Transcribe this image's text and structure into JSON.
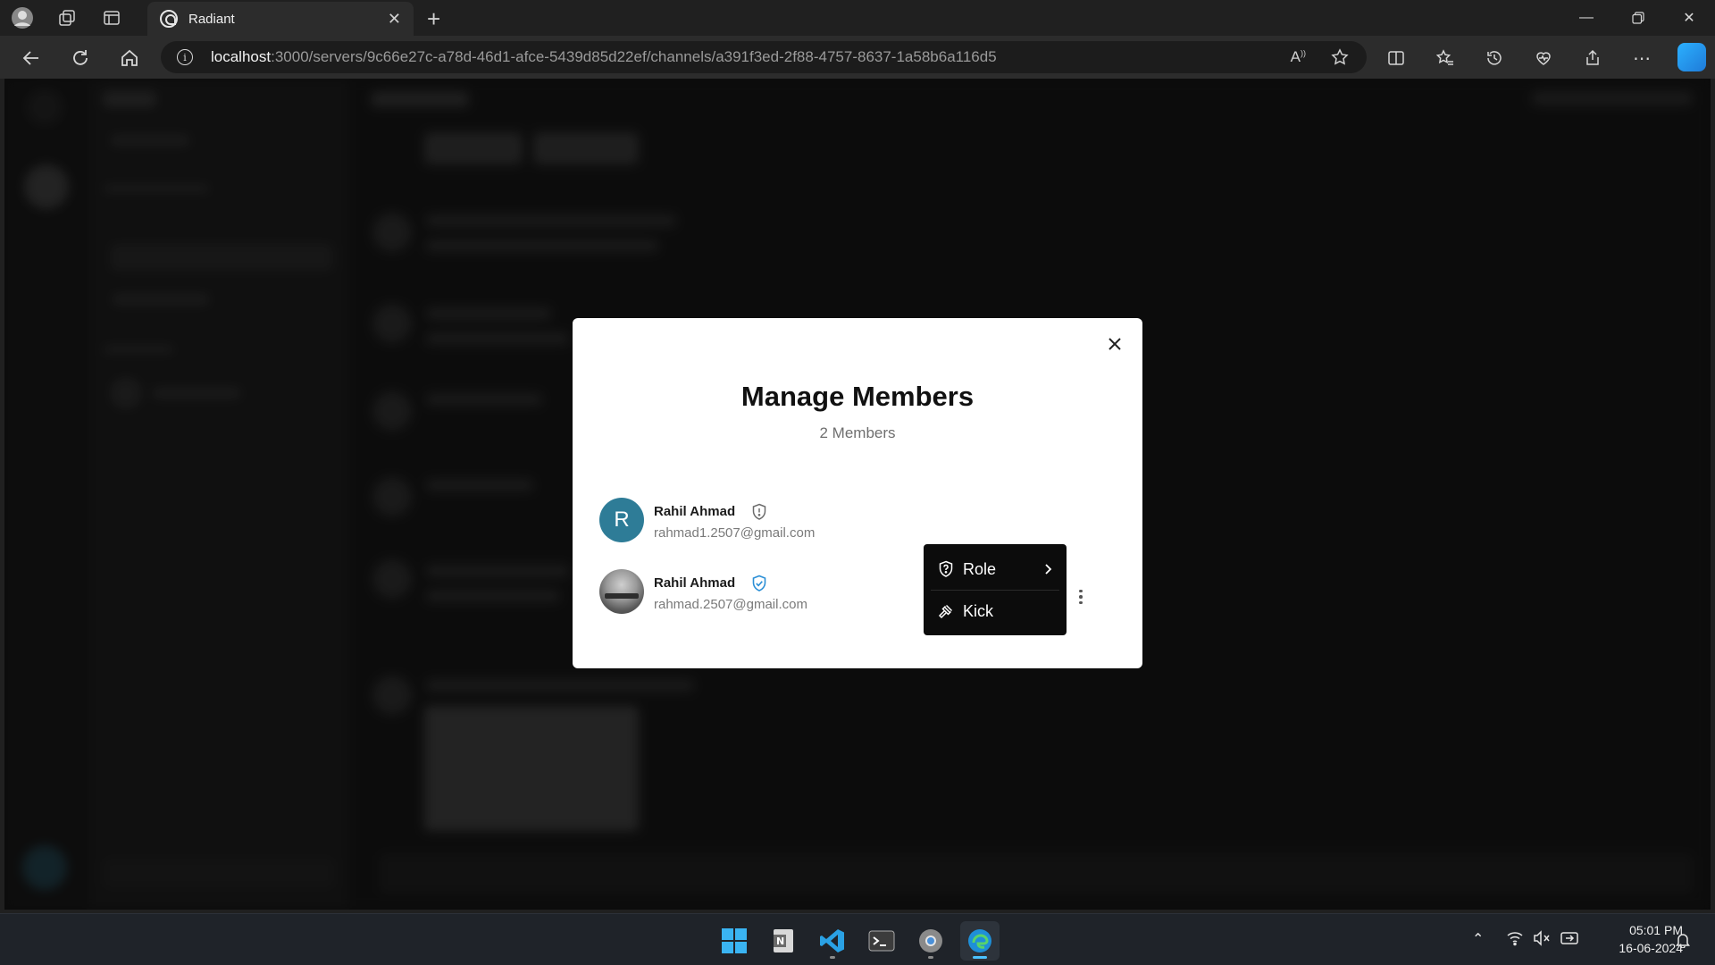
{
  "browser": {
    "tab_title": "Radiant",
    "url_host": "localhost",
    "url_rest": ":3000/servers/9c66e27c-a78d-46d1-afce-5439d85d22ef/channels/a391f3ed-2f88-4757-8637-1a58b6a116d5"
  },
  "modal": {
    "title": "Manage Members",
    "subtitle": "2 Members",
    "members": [
      {
        "avatar_letter": "R",
        "name": "Rahil Ahmad",
        "email": "rahmad1.2507@gmail.com",
        "role_icon": "shield-alert-icon",
        "role_color": "#6b6b6b"
      },
      {
        "name": "Rahil Ahmad",
        "email": "rahmad.2507@gmail.com",
        "role_icon": "shield-check-icon",
        "role_color": "#2b8fd6"
      }
    ]
  },
  "menu": {
    "role_label": "Role",
    "kick_label": "Kick"
  },
  "taskbar": {
    "time": "05:01 PM",
    "date": "16-06-2024"
  },
  "colors": {
    "accent": "#4cc2ff",
    "avatar_teal": "#2e7c97"
  }
}
